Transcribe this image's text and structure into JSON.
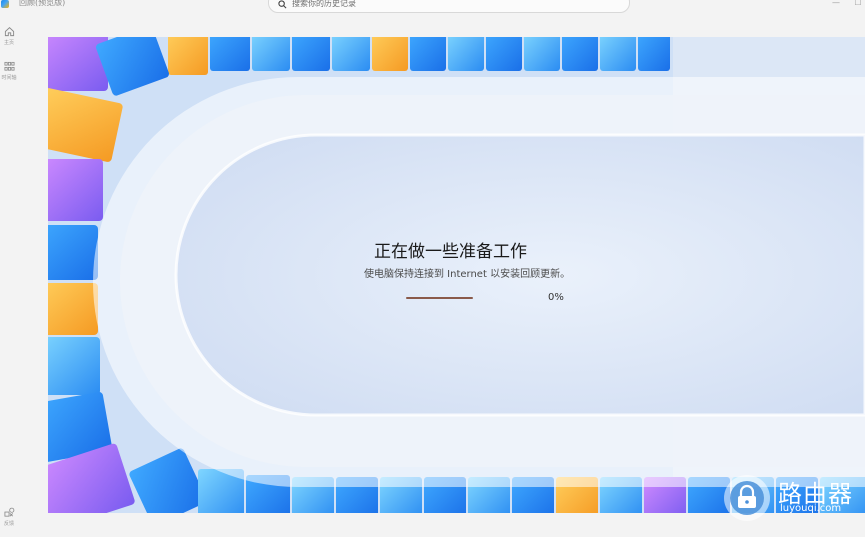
{
  "window": {
    "title": "回顾(预览版)",
    "minimize_glyph": "—",
    "maximize_glyph": "☐"
  },
  "search": {
    "placeholder": "搜索你的历史记录",
    "icon": "search-icon"
  },
  "sidebar": {
    "items": [
      {
        "label": "主页",
        "icon": "home-icon"
      },
      {
        "label": "时间轴",
        "icon": "grid-icon"
      },
      {
        "label": "反馈",
        "icon": "feedback-icon"
      }
    ]
  },
  "status": {
    "title": "正在做一些准备工作",
    "subtitle": "使电脑保持连接到 Internet 以安装回顾更新。",
    "progress_percent_label": "0%",
    "progress_value": 0
  },
  "watermark": {
    "text": "路由器",
    "url": "luyouqi.com",
    "icon": "router-lock-icon"
  },
  "colors": {
    "window_bg": "#f3f3f3",
    "panel_bg": "#dfe9f7",
    "progress": "#8a5a4a",
    "accent_blue": "#1e88e5",
    "accent_orange": "#ffb300",
    "accent_purple": "#b06ee8"
  }
}
